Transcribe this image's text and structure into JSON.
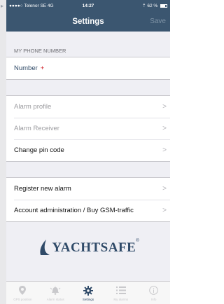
{
  "status_bar": {
    "carrier": "●●●●○ Telenor SE  4G",
    "time": "14:27",
    "right": "⇡ 62 %"
  },
  "nav": {
    "title": "Settings",
    "save_label": "Save"
  },
  "phone_section": {
    "header": "MY PHONE NUMBER",
    "number_label": "Number",
    "plus": "+"
  },
  "alarm_group": [
    {
      "label": "Alarm profile",
      "enabled": false
    },
    {
      "label": "Alarm Receiver",
      "enabled": false
    },
    {
      "label": "Change pin code",
      "enabled": true
    }
  ],
  "account_group": [
    {
      "label": "Register new alarm"
    },
    {
      "label": "Account administration / Buy GSM-traffic"
    }
  ],
  "logo": {
    "text": "YACHTSAFE",
    "registered": "®"
  },
  "tabbar": [
    {
      "label": "GPS position",
      "icon": "map-pin-icon",
      "active": false
    },
    {
      "label": "Alarm status",
      "icon": "alarm-bell-icon",
      "active": false
    },
    {
      "label": "Settings",
      "icon": "gear-icon",
      "active": true
    },
    {
      "label": "My alarms",
      "icon": "list-icon",
      "active": false
    },
    {
      "label": "Info",
      "icon": "info-icon",
      "active": false
    }
  ],
  "colors": {
    "header": "#3b5670",
    "accent": "#2f4a68",
    "plus": "#d0212a"
  }
}
